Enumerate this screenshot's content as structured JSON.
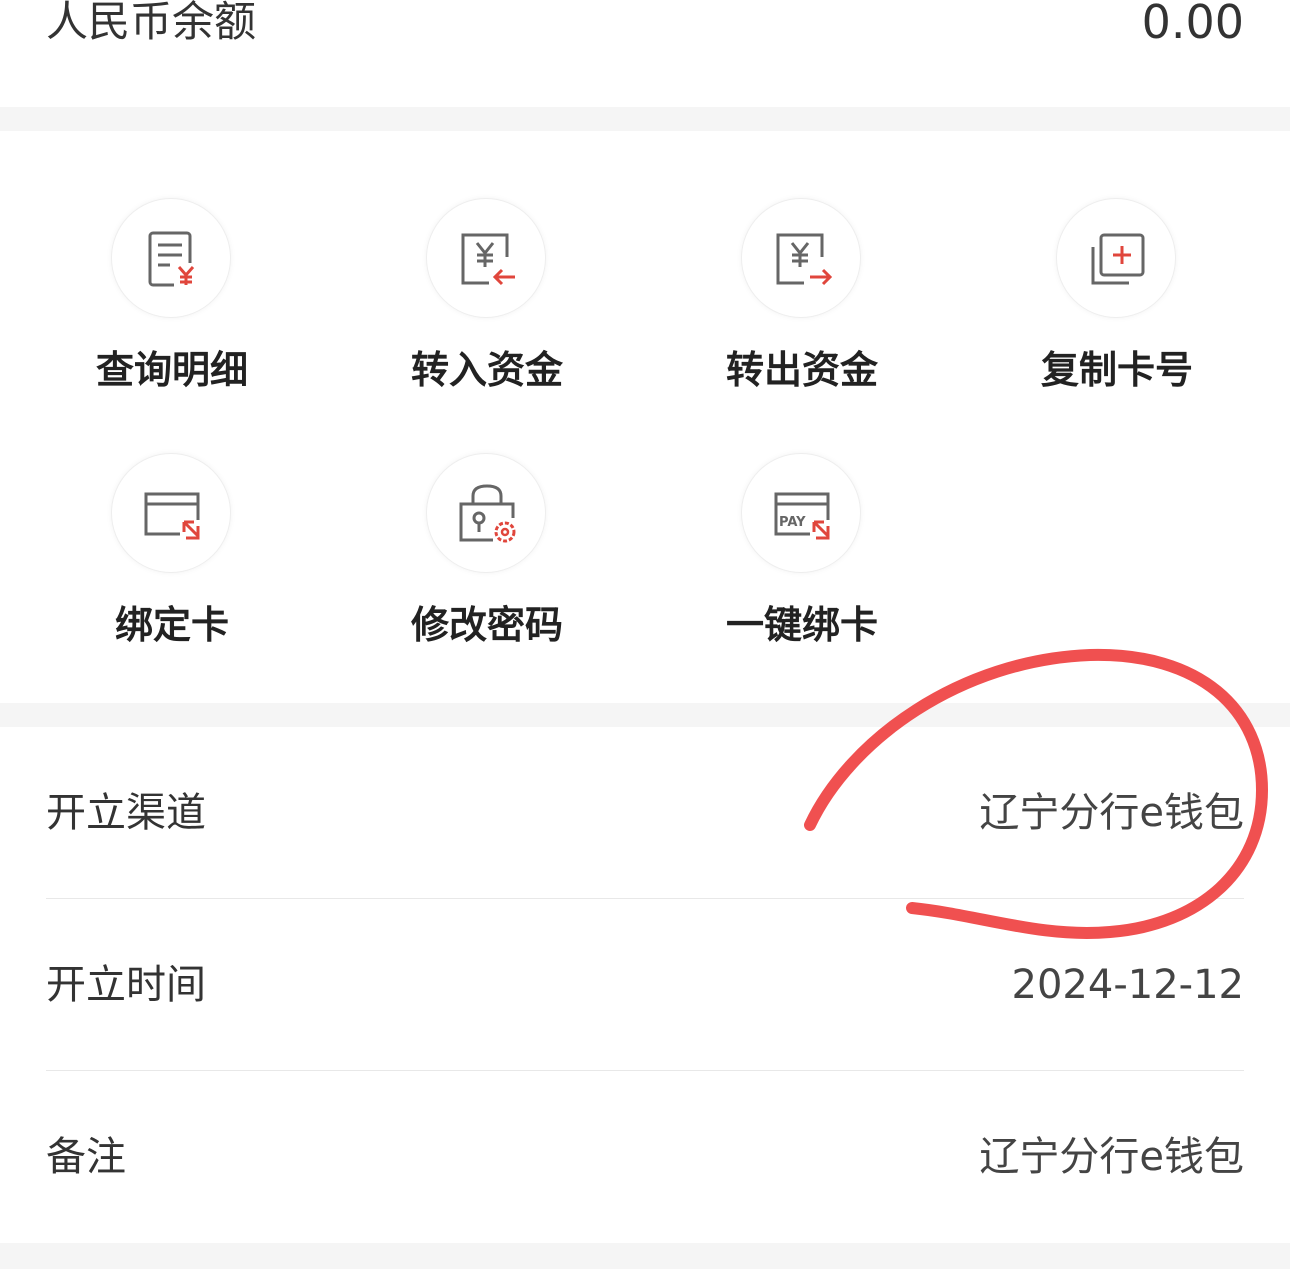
{
  "balance": {
    "label": "人民币余额",
    "value": "0.00"
  },
  "actions": [
    {
      "label": "查询明细",
      "icon": "statement-yuan-icon"
    },
    {
      "label": "转入资金",
      "icon": "transfer-in-yuan-icon"
    },
    {
      "label": "转出资金",
      "icon": "transfer-out-yuan-icon"
    },
    {
      "label": "复制卡号",
      "icon": "copy-card-icon"
    },
    {
      "label": "绑定卡",
      "icon": "bind-card-icon"
    },
    {
      "label": "修改密码",
      "icon": "lock-settings-icon"
    },
    {
      "label": "一键绑卡",
      "icon": "pay-card-icon"
    }
  ],
  "info": {
    "channel": {
      "label": "开立渠道",
      "value": "辽宁分行e钱包"
    },
    "time": {
      "label": "开立时间",
      "value": "2024-12-12"
    },
    "remark": {
      "label": "备注",
      "value": "辽宁分行e钱包"
    }
  },
  "colors": {
    "accent": "#e0463c",
    "icon_gray": "#666666",
    "annotation": "#f05050"
  }
}
